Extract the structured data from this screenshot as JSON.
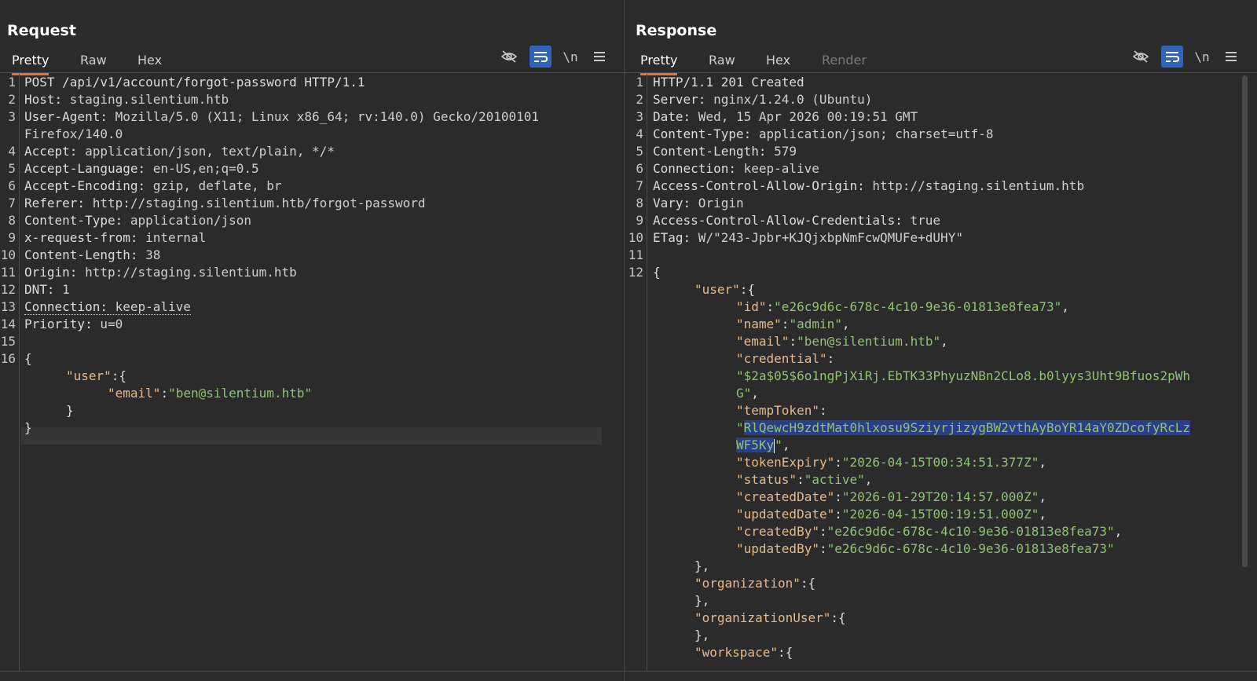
{
  "layout_buttons": [
    {
      "name": "split-columns",
      "active": true
    },
    {
      "name": "split-rows",
      "active": false
    },
    {
      "name": "single-pane",
      "active": false
    }
  ],
  "request": {
    "title": "Request",
    "tabs": [
      "Pretty",
      "Raw",
      "Hex"
    ],
    "active_tab": "Pretty",
    "tools": [
      "hide-icon",
      "wrap-icon",
      "newline-toggle",
      "menu-icon"
    ],
    "newline_label": "\\n",
    "line_numbers": [
      "1",
      "2",
      "3",
      "4",
      "5",
      "6",
      "7",
      "8",
      "9",
      "10",
      "11",
      "12",
      "13",
      "14",
      "15",
      "16"
    ],
    "headers": {
      "request_line": "POST /api/v1/account/forgot-password HTTP/1.1",
      "host": {
        "name": "Host:",
        "value": " staging.silentium.htb"
      },
      "user_agent": {
        "name": "User-Agent:",
        "value": " Mozilla/5.0 (X11; Linux x86_64; rv:140.0) Gecko/20100101",
        "cont": "Firefox/140.0"
      },
      "accept": {
        "name": "Accept:",
        "value": " application/json, text/plain, */*"
      },
      "accept_language": {
        "name": "Accept-Language:",
        "value": " en-US,en;q=0.5"
      },
      "accept_encoding": {
        "name": "Accept-Encoding:",
        "value": " gzip, deflate, br"
      },
      "referer": {
        "name": "Referer:",
        "value": " http://staging.silentium.htb/forgot-password"
      },
      "content_type": {
        "name": "Content-Type:",
        "value": " application/json"
      },
      "x_request_from": {
        "name": "x-request-from:",
        "value": " internal"
      },
      "content_length": {
        "name": "Content-Length:",
        "value": " 38"
      },
      "origin": {
        "name": "Origin:",
        "value": " http://staging.silentium.htb"
      },
      "dnt": {
        "name": "DNT:",
        "value": " 1"
      },
      "connection": {
        "name": "Connection:",
        "value": " keep-alive"
      },
      "priority": {
        "name": "Priority:",
        "value": " u=0"
      }
    },
    "body": {
      "open": "{",
      "user_key": "\"user\"",
      "user_open": ":{",
      "email_key": "\"email\"",
      "colon": ":",
      "email_val": "\"ben@silentium.htb\"",
      "user_close": "}",
      "close": "}"
    }
  },
  "response": {
    "title": "Response",
    "tabs": [
      "Pretty",
      "Raw",
      "Hex",
      "Render"
    ],
    "active_tab": "Pretty",
    "newline_label": "\\n",
    "line_numbers": [
      "1",
      "2",
      "3",
      "4",
      "5",
      "6",
      "7",
      "8",
      "9",
      "10",
      "11",
      "12"
    ],
    "headers": {
      "status_line": "HTTP/1.1 201 Created",
      "server": {
        "name": "Server:",
        "value": " nginx/1.24.0 (Ubuntu)"
      },
      "date": {
        "name": "Date:",
        "value": " Wed, 15 Apr 2026 00:19:51 GMT"
      },
      "content_type": {
        "name": "Content-Type:",
        "value": " application/json; charset=utf-8"
      },
      "content_length": {
        "name": "Content-Length:",
        "value": " 579"
      },
      "connection": {
        "name": "Connection:",
        "value": " keep-alive"
      },
      "acao": {
        "name": "Access-Control-Allow-Origin:",
        "value": " http://staging.silentium.htb"
      },
      "vary": {
        "name": "Vary:",
        "value": " Origin"
      },
      "acac": {
        "name": "Access-Control-Allow-Credentials:",
        "value": " true"
      },
      "etag": {
        "name": "ETag:",
        "value": " W/\"243-Jpbr+KJQjxbpNmFcwQMUFe+dUHY\""
      }
    },
    "body": {
      "open": "{",
      "user_key": "\"user\"",
      "obj_open": ":{",
      "colon": ":",
      "comma": ",",
      "id_key": "\"id\"",
      "id_val": "\"e26c9d6c-678c-4c10-9e36-01813e8fea73\"",
      "name_key": "\"name\"",
      "name_val": "\"admin\"",
      "email_key": "\"email\"",
      "email_val": "\"ben@silentium.htb\"",
      "credential_key": "\"credential\"",
      "credential_val_1": "\"$2a$05$6o1ngPjXiRj.EbTK33PhyuzNBn2CLo8.b0lyys3Uht9Bfuos2pWh",
      "credential_val_2": "G\"",
      "temptoken_key": "\"tempToken\"",
      "temptoken_q": "\"",
      "temptoken_sel_1": "RlQewcH9zdtMat0hlxosu9SziyrjizygBW2vthAyBoYR14aY0ZDcofyRcLz",
      "temptoken_sel_2": "WF5Ky",
      "temptoken_end": "\"",
      "tokenexpiry_key": "\"tokenExpiry\"",
      "tokenexpiry_val": "\"2026-04-15T00:34:51.377Z\"",
      "status_key": "\"status\"",
      "status_val": "\"active\"",
      "createddate_key": "\"createdDate\"",
      "createddate_val": "\"2026-01-29T20:14:57.000Z\"",
      "updateddate_key": "\"updatedDate\"",
      "updateddate_val": "\"2026-04-15T00:19:51.000Z\"",
      "createdby_key": "\"createdBy\"",
      "createdby_val": "\"e26c9d6c-678c-4c10-9e36-01813e8fea73\"",
      "updatedby_key": "\"updatedBy\"",
      "updatedby_val": "\"e26c9d6c-678c-4c10-9e36-01813e8fea73\"",
      "obj_close_comma": "},",
      "organization_key": "\"organization\"",
      "organizationuser_key": "\"organizationUser\"",
      "workspace_key": "\"workspace\""
    }
  }
}
